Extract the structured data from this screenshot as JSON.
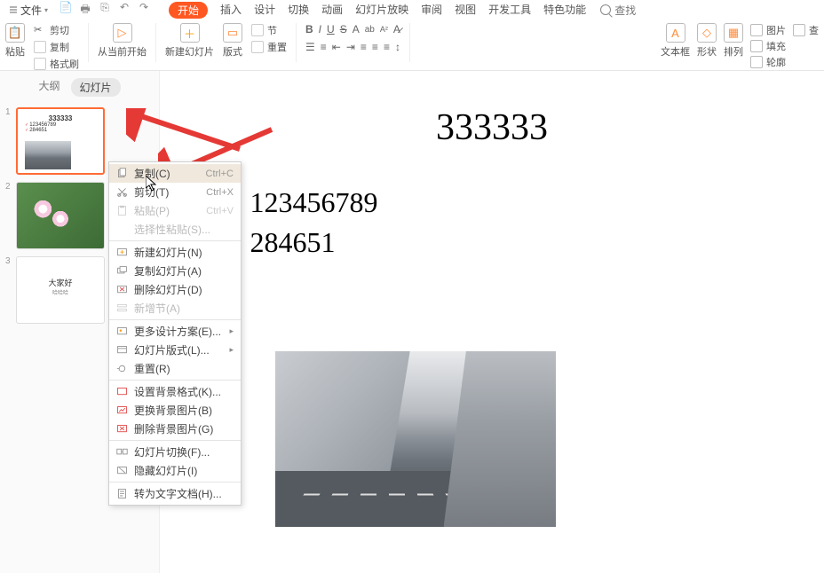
{
  "menubar": {
    "file": "文件",
    "tabs": [
      "开始",
      "插入",
      "设计",
      "切换",
      "动画",
      "幻灯片放映",
      "审阅",
      "视图",
      "开发工具",
      "特色功能"
    ],
    "search": "查找"
  },
  "ribbon": {
    "paste": "粘贴",
    "cut": "剪切",
    "copy": "复制",
    "format_painter": "格式刷",
    "from_begin": "从当前开始",
    "new_slide": "新建幻灯片",
    "layout": "版式",
    "section": "节",
    "reset": "重置",
    "text_box": "文本框",
    "shape": "形状",
    "arrange": "排列",
    "picture": "图片",
    "fill": "填充",
    "outline": "轮廓",
    "find": "查"
  },
  "panel_tabs": {
    "outline": "大纲",
    "slides": "幻灯片"
  },
  "thumbs": [
    {
      "num": "1",
      "title": "333333",
      "l1": "123456789",
      "l2": "284651"
    },
    {
      "num": "2"
    },
    {
      "num": "3",
      "title": "大家好",
      "sub": "哈哈哈"
    }
  ],
  "context_menu": [
    {
      "icon": "copy",
      "label": "复制(C)",
      "shortcut": "Ctrl+C",
      "hover": true
    },
    {
      "icon": "cut",
      "label": "剪切(T)",
      "shortcut": "Ctrl+X"
    },
    {
      "icon": "paste",
      "label": "粘贴(P)",
      "shortcut": "Ctrl+V",
      "disabled": true
    },
    {
      "icon": "blank",
      "label": "选择性粘贴(S)...",
      "disabled": true
    },
    {
      "sep": true
    },
    {
      "icon": "newslide",
      "label": "新建幻灯片(N)"
    },
    {
      "icon": "dupslide",
      "label": "复制幻灯片(A)"
    },
    {
      "icon": "delslide",
      "label": "删除幻灯片(D)"
    },
    {
      "icon": "section",
      "label": "新增节(A)",
      "disabled": true
    },
    {
      "sep": true
    },
    {
      "icon": "design",
      "label": "更多设计方案(E)...",
      "arrow": true
    },
    {
      "icon": "layout",
      "label": "幻灯片版式(L)...",
      "arrow": true
    },
    {
      "icon": "reset",
      "label": "重置(R)"
    },
    {
      "sep": true
    },
    {
      "icon": "bgfmt",
      "label": "设置背景格式(K)..."
    },
    {
      "icon": "bgimg",
      "label": "更换背景图片(B)"
    },
    {
      "icon": "bgdel",
      "label": "删除背景图片(G)"
    },
    {
      "sep": true
    },
    {
      "icon": "trans",
      "label": "幻灯片切换(F)..."
    },
    {
      "icon": "hide",
      "label": "隐藏幻灯片(I)"
    },
    {
      "sep": true
    },
    {
      "icon": "toword",
      "label": "转为文字文档(H)..."
    }
  ],
  "slide": {
    "title": "333333",
    "bullets": [
      "123456789",
      "284651"
    ]
  }
}
